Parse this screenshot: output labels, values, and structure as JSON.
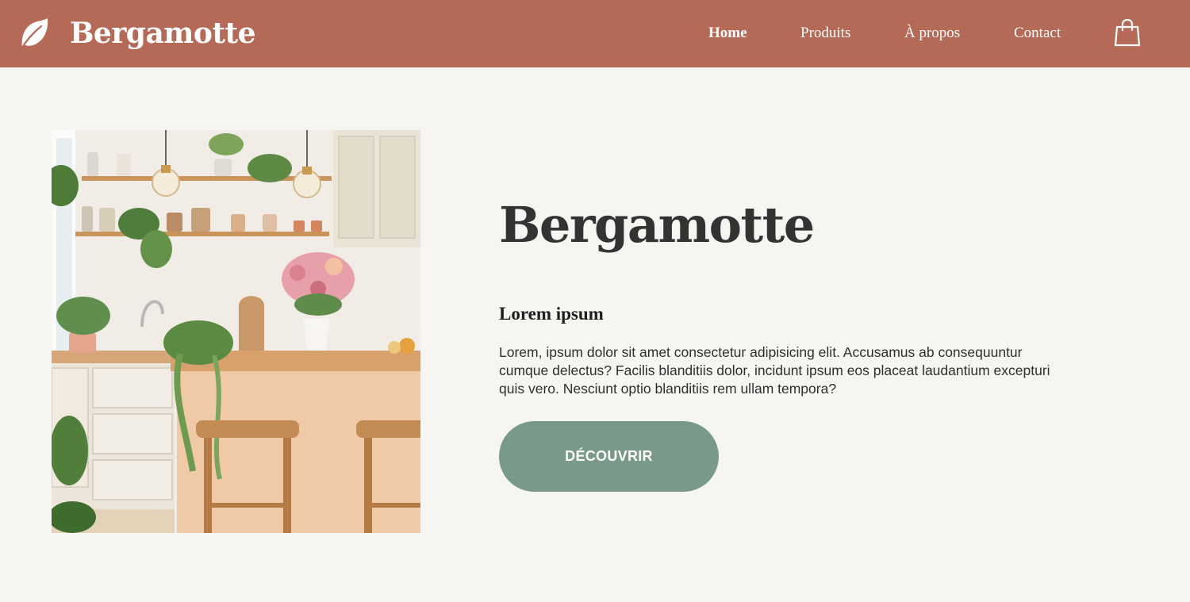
{
  "header": {
    "brand": "Bergamotte",
    "logo_icon": "leaf-icon",
    "cart_icon": "shopping-bag-icon",
    "nav": {
      "home": "Home",
      "produits": "Produits",
      "apropos": "À propos",
      "contact": "Contact"
    }
  },
  "hero": {
    "image": "kitchen-with-plants-and-stools",
    "title": "Bergamotte",
    "subtitle": "Lorem ipsum",
    "paragraph": "Lorem, ipsum dolor sit amet consectetur adipisicing elit. Accusamus ab consequuntur cumque delectus? Facilis blanditiis dolor, incidunt ipsum eos placeat laudantium excepturi quis vero. Nesciunt optio blanditiis rem ullam tempora?",
    "cta_label": "DÉCOUVRIR"
  },
  "colors": {
    "header_bg": "#b56a58",
    "page_bg": "#f7f5f2",
    "cta_bg": "#7a9a89",
    "title_text": "#333333"
  }
}
